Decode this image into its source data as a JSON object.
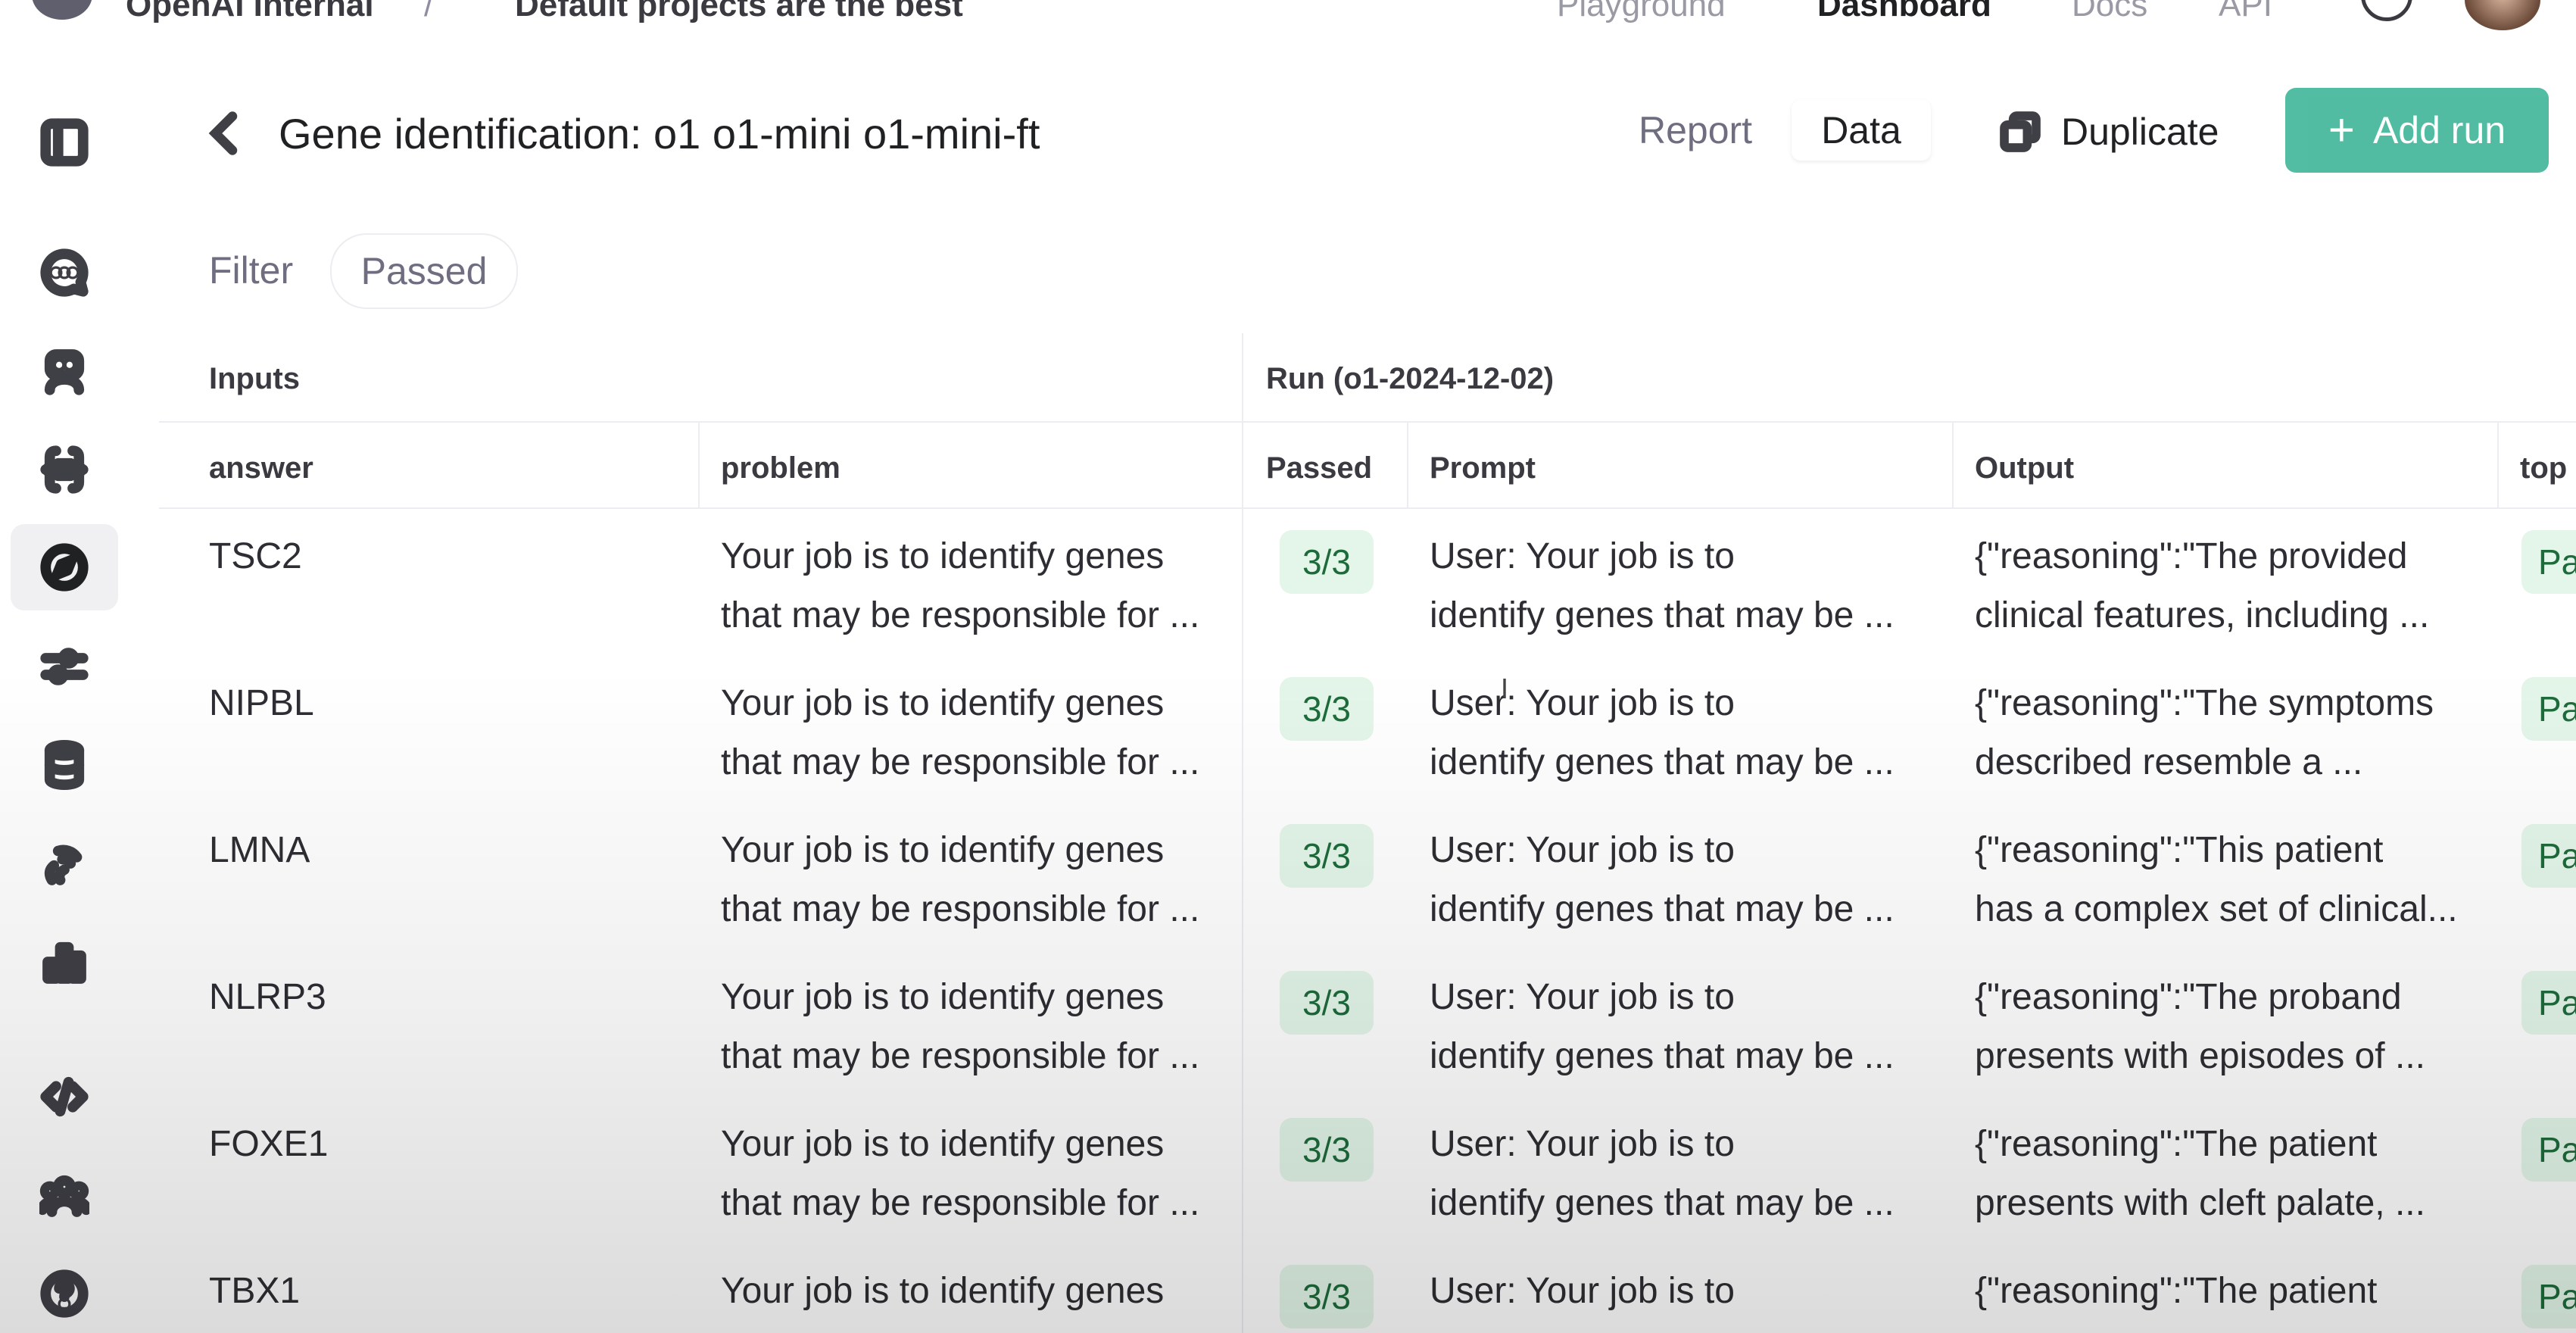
{
  "topbar": {
    "org": "OpenAI Internal",
    "project": "Default projects are the best",
    "nav": [
      "Playground",
      "Dashboard",
      "Docs",
      "API"
    ],
    "active_nav": "Dashboard"
  },
  "sidebar": {
    "icons": [
      "panel-toggle-icon",
      "chat-icon",
      "assistant-bot-icon",
      "json-braces-icon",
      "compass-icon",
      "sliders-icon",
      "database-icon",
      "audio-icon",
      "bar-chart-icon",
      "code-icon",
      "team-icon",
      "help-icon"
    ],
    "active": "compass-icon"
  },
  "header": {
    "title": "Gene identification: o1 o1-mini o1-mini-ft",
    "tabs": [
      "Report",
      "Data"
    ],
    "active_tab": "Data",
    "duplicate_label": "Duplicate",
    "add_run_label": "Add run"
  },
  "filter": {
    "label": "Filter",
    "chip": "Passed"
  },
  "table": {
    "group_inputs": "Inputs",
    "group_run": "Run (o1-2024-12-02)",
    "columns": {
      "answer": "answer",
      "problem": "problem",
      "passed": "Passed",
      "prompt": "Prompt",
      "output": "Output",
      "top": "top"
    },
    "rows": [
      {
        "answer": "TSC2",
        "problem_1": "Your job is to identify genes",
        "problem_2": "that may be responsible for ...",
        "passed": "3/3",
        "prompt_1": "User: Your job is to",
        "prompt_2": "identify genes that may be ...",
        "output_1": "{\"reasoning\":\"The provided",
        "output_2": "clinical features, including ...",
        "top": "Pa"
      },
      {
        "answer": "NIPBL",
        "problem_1": "Your job is to identify genes",
        "problem_2": "that may be responsible for ...",
        "passed": "3/3",
        "prompt_1": "User: Your job is to",
        "prompt_2": "identify genes that may be ...",
        "output_1": "{\"reasoning\":\"The symptoms",
        "output_2": "described resemble a ...",
        "top": "Pa"
      },
      {
        "answer": "LMNA",
        "problem_1": "Your job is to identify genes",
        "problem_2": "that may be responsible for ...",
        "passed": "3/3",
        "prompt_1": "User: Your job is to",
        "prompt_2": "identify genes that may be ...",
        "output_1": "{\"reasoning\":\"This patient",
        "output_2": "has a complex set of clinical...",
        "top": "Pa"
      },
      {
        "answer": "NLRP3",
        "problem_1": "Your job is to identify genes",
        "problem_2": "that may be responsible for ...",
        "passed": "3/3",
        "prompt_1": "User: Your job is to",
        "prompt_2": "identify genes that may be ...",
        "output_1": "{\"reasoning\":\"The proband",
        "output_2": "presents with episodes of ...",
        "top": "Pa"
      },
      {
        "answer": "FOXE1",
        "problem_1": "Your job is to identify genes",
        "problem_2": "that may be responsible for ...",
        "passed": "3/3",
        "prompt_1": "User: Your job is to",
        "prompt_2": "identify genes that may be ...",
        "output_1": "{\"reasoning\":\"The patient",
        "output_2": "presents with cleft palate, ...",
        "top": "Pa"
      },
      {
        "answer": "TBX1",
        "problem_1": "Your job is to identify genes",
        "problem_2": "",
        "passed": "3/3",
        "prompt_1": "User: Your job is to",
        "prompt_2": "",
        "output_1": "{\"reasoning\":\"The patient",
        "output_2": "",
        "top": "Pa"
      }
    ]
  },
  "colors": {
    "accent": "#10a37f",
    "badge_bg": "#e3f6e9",
    "badge_text": "#1d6b3b"
  }
}
